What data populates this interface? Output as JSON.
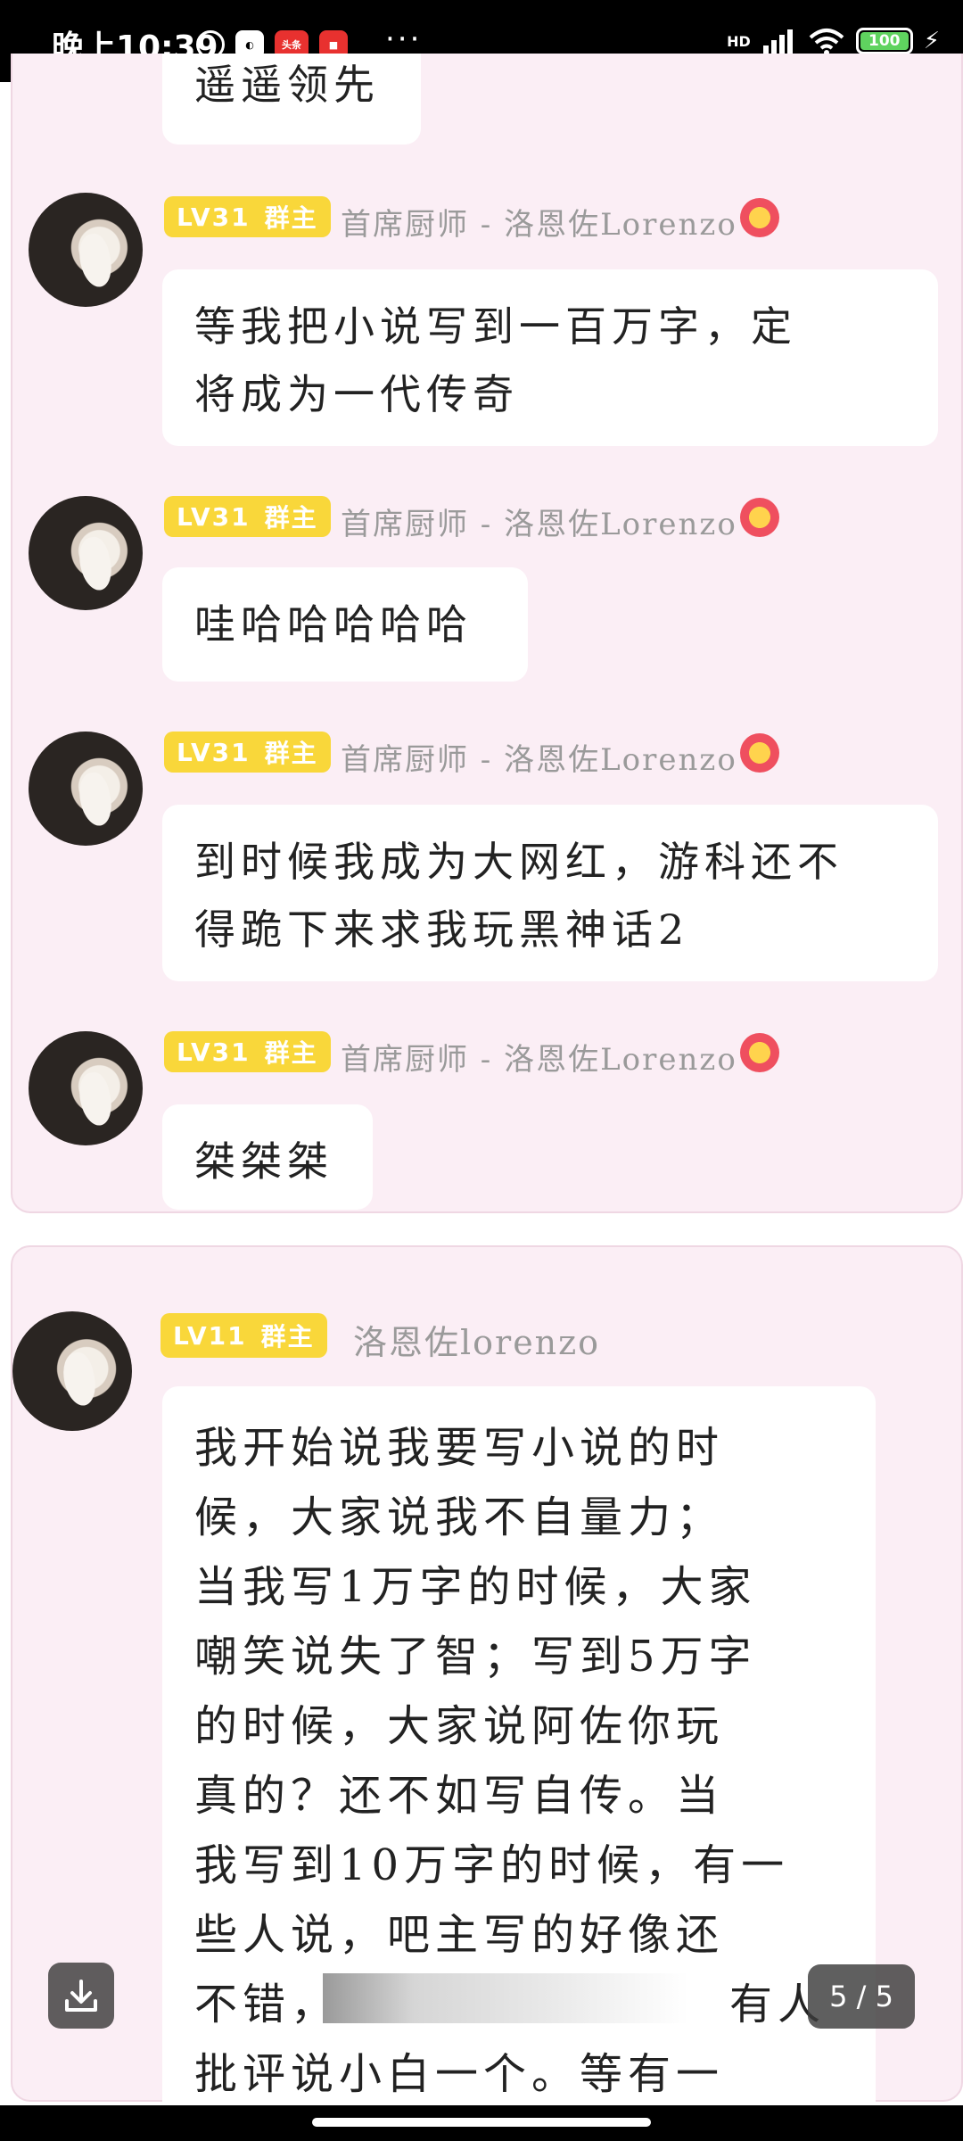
{
  "status_bar": {
    "time": "晚上10:39",
    "app_icons": [
      "alarm-icon",
      "app-icon",
      "toutiao-icon",
      "news-icon"
    ],
    "toutiao_label": "头条",
    "more": "···",
    "network": "HD",
    "battery": "100"
  },
  "page_indicator": "5 / 5",
  "card1": {
    "top_partial_text": "遥遥领先",
    "messages": [
      {
        "level": "LV31",
        "role": "群主",
        "name": "首席厨师 - 洛恩佐Lorenzo",
        "text_lines": [
          "等我把小说写到一百万字，定",
          "将成为一代传奇"
        ]
      },
      {
        "level": "LV31",
        "role": "群主",
        "name": "首席厨师 - 洛恩佐Lorenzo",
        "text_lines": [
          "哇哈哈哈哈哈"
        ]
      },
      {
        "level": "LV31",
        "role": "群主",
        "name": "首席厨师 - 洛恩佐Lorenzo",
        "text_lines": [
          "到时候我成为大网红，游科还不",
          "得跪下来求我玩黑神话2"
        ]
      },
      {
        "level": "LV31",
        "role": "群主",
        "name": "首席厨师 - 洛恩佐Lorenzo",
        "text_lines": [
          "桀桀桀"
        ]
      }
    ]
  },
  "card2": {
    "level": "LV11",
    "role": "群主",
    "name": "洛恩佐lorenzo",
    "text_lines": [
      "我开始说我要写小说的时",
      "候，大家说我不自量力；",
      "当我写1万字的时候，大家",
      "嘲笑说失了智；写到5万字",
      "的时候，大家说阿佐你玩",
      "真的？还不如写自传。当",
      "我写到10万字的时候，有一",
      "些人说，吧主写的好像还",
      "不错，",
      "批评说小白一个。等有一"
    ],
    "line9_tail": "有人"
  }
}
